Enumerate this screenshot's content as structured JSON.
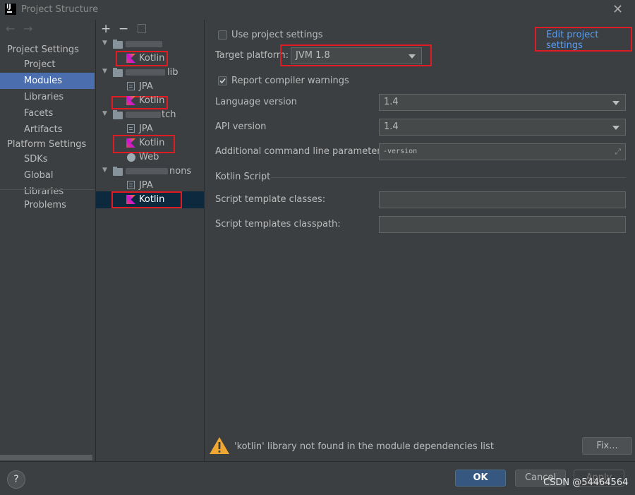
{
  "window": {
    "title": "Project Structure",
    "app_icon": "IJ"
  },
  "sidebar": {
    "sections": [
      {
        "label": "Project Settings",
        "items": [
          {
            "label": "Project"
          },
          {
            "label": "Modules"
          },
          {
            "label": "Libraries"
          },
          {
            "label": "Facets"
          },
          {
            "label": "Artifacts"
          }
        ]
      },
      {
        "label": "Platform Settings",
        "items": [
          {
            "label": "SDKs"
          },
          {
            "label": "Global Libraries"
          }
        ]
      }
    ],
    "problems": "Problems",
    "selected": "Modules"
  },
  "tree": {
    "nodes": [
      {
        "suffix": "",
        "children": [
          "Kotlin"
        ]
      },
      {
        "suffix": "lib",
        "children": [
          "JPA",
          "Kotlin"
        ]
      },
      {
        "suffix": "tch",
        "children": [
          "JPA",
          "Kotlin",
          "Web"
        ]
      },
      {
        "suffix": "nons",
        "children": [
          "JPA",
          "Kotlin"
        ]
      }
    ]
  },
  "settings": {
    "use_project_settings": {
      "label": "Use project settings",
      "checked": false
    },
    "edit_link": "Edit project settings",
    "target_platform": {
      "label": "Target platform:",
      "value": "JVM 1.8"
    },
    "report_warnings": {
      "label": "Report compiler warnings",
      "checked": true
    },
    "language_version": {
      "label": "Language version",
      "value": "1.4"
    },
    "api_version": {
      "label": "API version",
      "value": "1.4"
    },
    "additional_params": {
      "label": "Additional command line parameters:",
      "value": "-version"
    },
    "kotlin_script_header": "Kotlin Script",
    "script_template_classes": {
      "label": "Script template classes:",
      "value": ""
    },
    "script_templates_classpath": {
      "label": "Script templates classpath:",
      "value": ""
    }
  },
  "warning": {
    "text": "'kotlin' library not found in the module dependencies list",
    "fix_label": "Fix..."
  },
  "buttons": {
    "ok": "OK",
    "cancel": "Cancel",
    "apply": "Apply",
    "help": "?"
  },
  "watermark": "CSDN @54464564",
  "colors": {
    "accent_selection": "#4b6eaf",
    "link": "#589df6",
    "annotation_box": "#e01b24",
    "warning": "#f0a732"
  }
}
